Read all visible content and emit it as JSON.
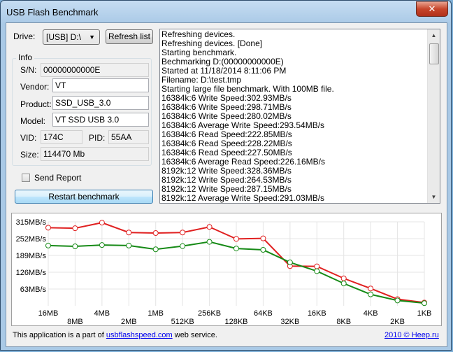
{
  "window": {
    "title": "USB Flash Benchmark",
    "close_glyph": "✕"
  },
  "drive": {
    "label": "Drive:",
    "selected": "[USB] D:\\",
    "refresh_label": "Refresh list"
  },
  "info": {
    "group_title": "Info",
    "sn_label": "S/N:",
    "sn": "00000000000E",
    "vendor_label": "Vendor:",
    "vendor": "VT",
    "product_label": "Product:",
    "product": "SSD_USB_3.0",
    "model_label": "Model:",
    "model": "VT SSD USB 3.0",
    "vid_label": "VID:",
    "vid": "174C",
    "pid_label": "PID:",
    "pid": "55AA",
    "size_label": "Size:",
    "size": "114470 Mb"
  },
  "send_report": {
    "label": "Send Report",
    "checked": false
  },
  "restart_button": "Restart benchmark",
  "log": [
    "Refreshing devices.",
    "Refreshing devices. [Done]",
    "Starting benchmark.",
    "Bechmarking D:(00000000000E)",
    "Started at 11/18/2014 8:11:06 PM",
    "Filename: D:\\test.tmp",
    "Starting large file benchmark. With 100MB file.",
    "16384k:6 Write Speed:302.93MB/s",
    "16384k:6 Write Speed:298.71MB/s",
    "16384k:6 Write Speed:280.02MB/s",
    "16384k:6 Average Write Speed:293.54MB/s",
    "16384k:6 Read Speed:222.85MB/s",
    "16384k:6 Read Speed:228.22MB/s",
    "16384k:6 Read Speed:227.50MB/s",
    "16384k:6 Average Read Speed:226.16MB/s",
    "8192k:12 Write Speed:328.36MB/s",
    "8192k:12 Write Speed:264.53MB/s",
    "8192k:12 Write Speed:287.15MB/s",
    "8192k:12 Average Write Speed:291.03MB/s"
  ],
  "chart_data": {
    "type": "line",
    "categories": [
      "16MB",
      "8MB",
      "4MB",
      "2MB",
      "1MB",
      "512KB",
      "256KB",
      "128KB",
      "64KB",
      "32KB",
      "16KB",
      "8KB",
      "4KB",
      "2KB",
      "1KB"
    ],
    "ytick_labels": [
      "315MB/s",
      "252MB/s",
      "189MB/s",
      "126MB/s",
      "63MB/s"
    ],
    "yticks": [
      315,
      252,
      189,
      126,
      63
    ],
    "ylim": [
      0,
      315
    ],
    "grid": true,
    "series": [
      {
        "color": "#e02020",
        "values": [
          293,
          291,
          312,
          275,
          273,
          275,
          296,
          251,
          253,
          149,
          148,
          103,
          65,
          25,
          12
        ]
      },
      {
        "color": "#168a16",
        "values": [
          226,
          223,
          228,
          226,
          212,
          224,
          240,
          215,
          210,
          163,
          130,
          84,
          43,
          20,
          10
        ]
      }
    ]
  },
  "footer": {
    "text_prefix": "This application is a part of ",
    "link": "usbflashspeed.com",
    "text_suffix": " web service.",
    "copyright_link": "2010 © Heep.ru"
  }
}
